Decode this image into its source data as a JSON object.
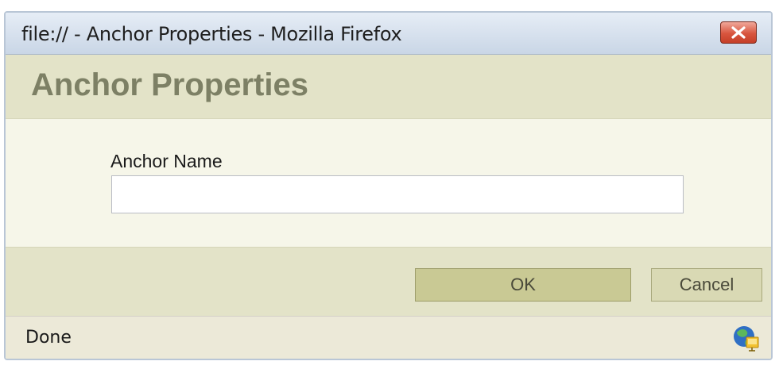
{
  "window": {
    "title": "file:// - Anchor Properties - Mozilla Firefox"
  },
  "titlebar": {
    "close_icon": "close-icon"
  },
  "dialog": {
    "heading": "Anchor Properties",
    "anchor_name_label": "Anchor Name",
    "anchor_name_value": "",
    "anchor_name_placeholder": ""
  },
  "buttons": {
    "ok_label": "OK",
    "cancel_label": "Cancel"
  },
  "statusbar": {
    "status_text": "Done",
    "status_icon": "network-globe-icon"
  },
  "colors": {
    "title_bar": "#c9d6e6",
    "close_button": "#d8553e",
    "header_band": "#e3e3c8",
    "heading_text": "#7d8065",
    "ok_button": "#c9c994",
    "cancel_button": "#d9d9b4",
    "status_bar": "#ece9d8"
  }
}
